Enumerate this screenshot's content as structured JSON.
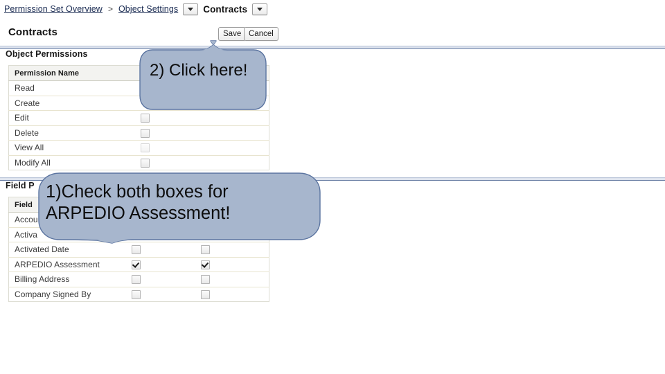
{
  "breadcrumb": {
    "items": [
      {
        "label": "Permission Set Overview",
        "type": "link"
      },
      {
        "label": ">",
        "type": "separator"
      },
      {
        "label": "Object Settings",
        "type": "link"
      },
      {
        "label": "Contracts",
        "type": "current"
      }
    ],
    "dropdown_icon": "chevron-down-icon"
  },
  "header": {
    "title": "Contracts",
    "save_label": "Save",
    "cancel_label": "Cancel"
  },
  "object_permissions": {
    "section_title": "Object Permissions",
    "columns": [
      "Permission Name",
      "",
      ""
    ],
    "rows": [
      {
        "name": "Read",
        "cb1": "hidden",
        "cb2": "hidden"
      },
      {
        "name": "Create",
        "cb1": "hidden",
        "cb2": "hidden"
      },
      {
        "name": "Edit",
        "cb1": "unchecked",
        "cb2": "hidden"
      },
      {
        "name": "Delete",
        "cb1": "unchecked",
        "cb2": "hidden"
      },
      {
        "name": "View All",
        "cb1": "unchecked",
        "cb2": "hidden"
      },
      {
        "name": "Modify All",
        "cb1": "unchecked",
        "cb2": "hidden"
      }
    ]
  },
  "field_permissions": {
    "section_title": "Field Permissions",
    "section_title_visible": "Field P",
    "columns": [
      "Field",
      "",
      ""
    ],
    "rows": [
      {
        "name": "Accou",
        "name_full": "Account",
        "cb1": "hidden",
        "cb2": "hidden"
      },
      {
        "name": "Activa",
        "name_full": "Activated By",
        "cb1": "hidden",
        "cb2": "hidden"
      },
      {
        "name": "Activated Date",
        "name_full": "Activated Date",
        "cb1": "unchecked",
        "cb2": "unchecked"
      },
      {
        "name": "ARPEDIO Assessment",
        "name_full": "ARPEDIO Assessment",
        "cb1": "checked",
        "cb2": "checked"
      },
      {
        "name": "Billing Address",
        "name_full": "Billing Address",
        "cb1": "unchecked",
        "cb2": "unchecked"
      },
      {
        "name": "Company Signed By",
        "name_full": "Company Signed By",
        "cb1": "unchecked",
        "cb2": "unchecked"
      }
    ]
  },
  "callouts": {
    "click_here": {
      "text": "2) Click here!",
      "fill": "#a7b6cd",
      "stroke": "#5b74a0",
      "tail": "up"
    },
    "check_boxes": {
      "line1": "1)Check both boxes for",
      "line2": "ARPEDIO Assessment!",
      "text": "1)Check both boxes for\nARPEDIO Assessment!",
      "fill": "#a7b6cd",
      "stroke": "#5b74a0",
      "tail": "down"
    }
  },
  "colors": {
    "rule": "#6f83a8",
    "table_header_bg": "#f3f3f0",
    "row_divider": "#e8e4cf",
    "link": "#1a2b52"
  }
}
